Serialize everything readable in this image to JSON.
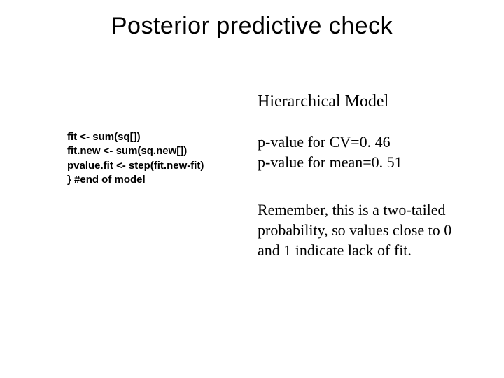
{
  "title": "Posterior predictive check",
  "code": {
    "line1": "fit <- sum(sq[])",
    "line2": "fit.new <- sum(sq.new[])",
    "line3": "pvalue.fit <- step(fit.new-fit)",
    "line4": "} #end of model"
  },
  "right": {
    "subheading": "Hierarchical Model",
    "pval_cv": "p-value for CV=0. 46",
    "pval_mean": "p-value for mean=0. 51",
    "note": "Remember, this is a two-tailed probability, so values close to 0 and 1 indicate lack of fit."
  }
}
